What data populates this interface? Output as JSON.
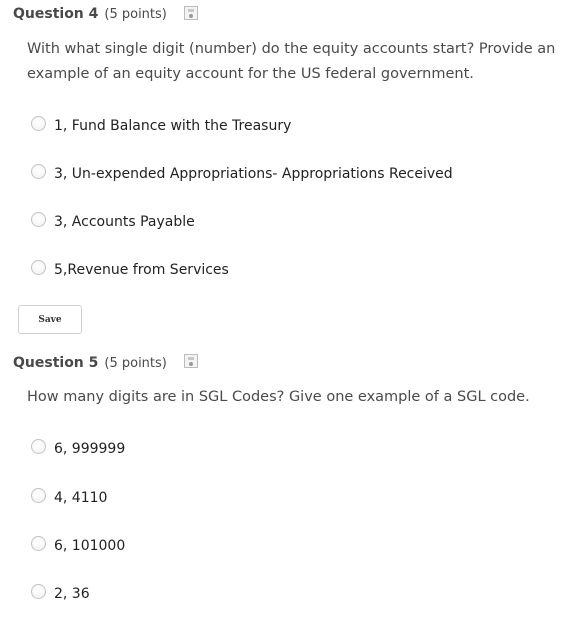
{
  "questions": [
    {
      "title": "Question 4",
      "points": "(5 points)",
      "text": "With what single digit (number) do the equity accounts start? Provide an example of an equity account for the US federal government.",
      "options": [
        "1, Fund Balance with the Treasury",
        "3, Un-expended Appropriations- Appropriations Received",
        "3, Accounts Payable",
        "5,Revenue from Services"
      ],
      "save_label": "Save"
    },
    {
      "title": "Question 5",
      "points": "(5 points)",
      "text": "How many digits are in SGL Codes? Give one example of a SGL code.",
      "options": [
        "6, 999999",
        "4, 4110",
        "6, 101000",
        "2, 36"
      ]
    }
  ],
  "icons": {
    "question_save": "save-icon",
    "radio": "radio-button"
  }
}
